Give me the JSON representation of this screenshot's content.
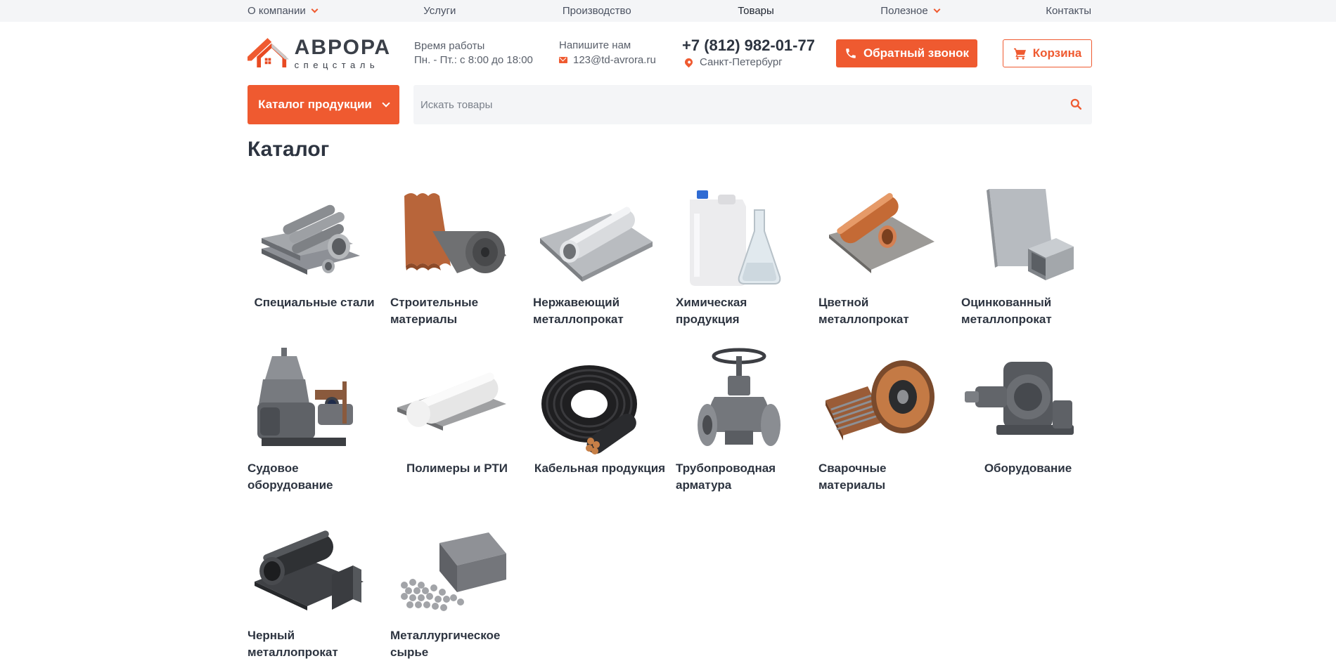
{
  "topnav": [
    {
      "label": "О компании",
      "dropdown": true
    },
    {
      "label": "Услуги",
      "dropdown": false
    },
    {
      "label": "Производство",
      "dropdown": false
    },
    {
      "label": "Товары",
      "dropdown": false,
      "active": true
    },
    {
      "label": "Полезное",
      "dropdown": true
    },
    {
      "label": "Контакты",
      "dropdown": false
    }
  ],
  "logo": {
    "name": "АВРОРА",
    "sub": "спецсталь"
  },
  "hours": {
    "title": "Время работы",
    "value": "Пн. - Пт.: с 8:00 до 18:00"
  },
  "email": {
    "title": "Напишите нам",
    "value": "123@td-avrora.ru"
  },
  "phone": {
    "number": "+7 (812) 982-01-77",
    "city": "Санкт-Петербург"
  },
  "buttons": {
    "callback": "Обратный звонок",
    "cart": "Корзина",
    "catalog": "Каталог продукции"
  },
  "search": {
    "placeholder": "Искать товары"
  },
  "page_title": "Каталог",
  "categories": [
    {
      "label": "Специальные стали",
      "icon": "special-steel"
    },
    {
      "label": "Строительные материалы",
      "icon": "construction-materials"
    },
    {
      "label": "Нержавеющий металлопрокат",
      "icon": "stainless-steel"
    },
    {
      "label": "Химическая продукция",
      "icon": "chemical-products"
    },
    {
      "label": "Цветной металлопрокат",
      "icon": "non-ferrous-metal"
    },
    {
      "label": "Оцинкованный металлопрокат",
      "icon": "galvanized-metal"
    },
    {
      "label": "Судовое оборудование",
      "icon": "marine-equipment"
    },
    {
      "label": "Полимеры и РТИ",
      "icon": "polymers"
    },
    {
      "label": "Кабельная продукция",
      "icon": "cable-products"
    },
    {
      "label": "Трубопроводная арматура",
      "icon": "pipeline-valves"
    },
    {
      "label": "Сварочные материалы",
      "icon": "welding-materials"
    },
    {
      "label": "Оборудование",
      "icon": "equipment"
    },
    {
      "label": "Черный металлопрокат",
      "icon": "ferrous-metal"
    },
    {
      "label": "Металлургическое сырье",
      "icon": "metallurgical-raw"
    }
  ],
  "colors": {
    "accent": "#ef5a30",
    "text": "#2d3440",
    "topbar_bg": "#f4f5f7"
  }
}
